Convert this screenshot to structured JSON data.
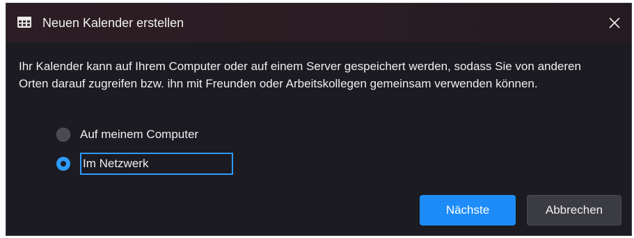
{
  "dialog": {
    "title": "Neuen Kalender erstellen",
    "title_icon": "calendar-icon",
    "close_icon": "close-icon",
    "description": "Ihr Kalender kann auf Ihrem Computer oder auf einem Server gespeichert werden, sodass Sie von anderen Orten darauf zugreifen bzw. ihn mit Freunden oder Arbeitskollegen gemeinsam verwenden können.",
    "options": [
      {
        "label": "Auf meinem Computer",
        "selected": false
      },
      {
        "label": "Im Netzwerk",
        "selected": true
      }
    ],
    "buttons": {
      "next": "Nächste",
      "cancel": "Abbrechen"
    }
  },
  "colors": {
    "background": "#1c1b22",
    "titlebar": "#2d1d24",
    "accent": "#1d8cf8",
    "text": "#f0f0f0"
  }
}
